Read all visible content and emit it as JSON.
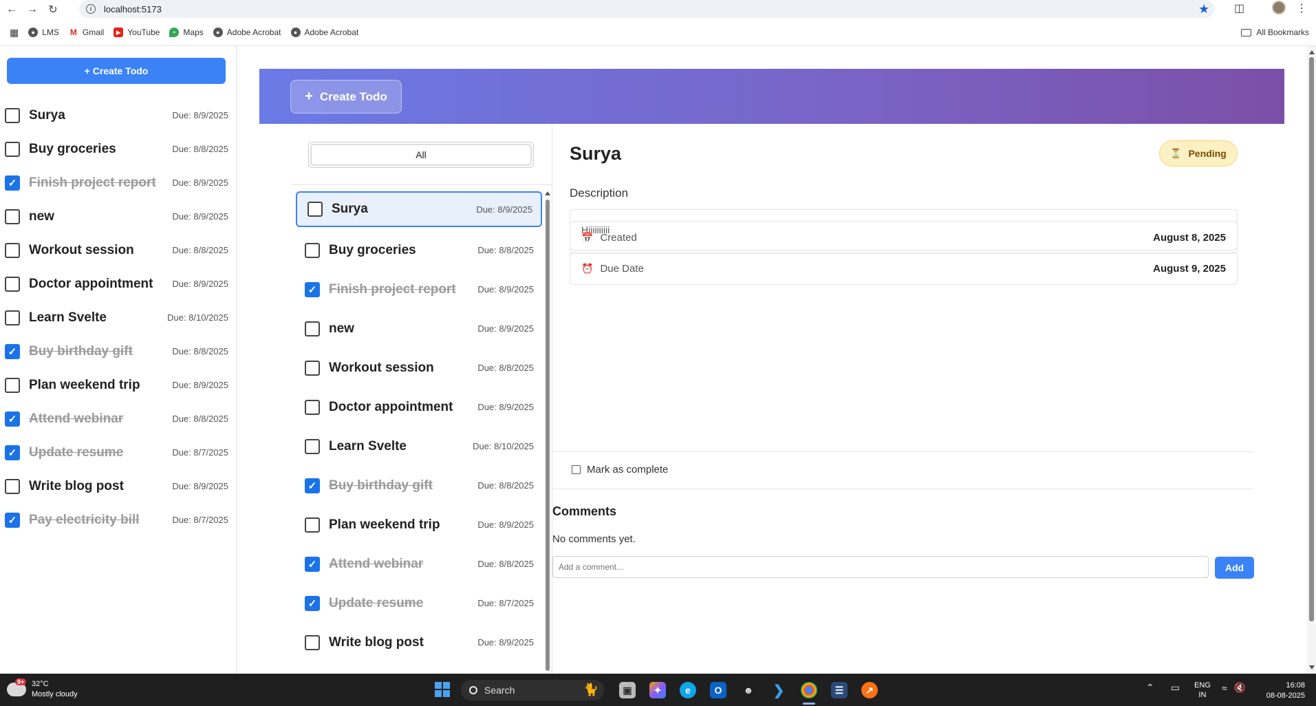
{
  "browser": {
    "url": "localhost:5173",
    "bookmarks": [
      {
        "label": "LMS",
        "icon": "globe-icon"
      },
      {
        "label": "Gmail",
        "icon": "gmail-icon"
      },
      {
        "label": "YouTube",
        "icon": "youtube-icon"
      },
      {
        "label": "Maps",
        "icon": "maps-icon"
      },
      {
        "label": "Adobe Acrobat",
        "icon": "globe-icon"
      },
      {
        "label": "Adobe Acrobat",
        "icon": "globe-icon"
      }
    ],
    "all_bookmarks": "All Bookmarks"
  },
  "sidebar": {
    "create_label": "+ Create Todo",
    "todos": [
      {
        "title": "Surya",
        "due": "Due: 8/9/2025",
        "done": false
      },
      {
        "title": "Buy groceries",
        "due": "Due: 8/8/2025",
        "done": false
      },
      {
        "title": "Finish project report",
        "due": "Due: 8/9/2025",
        "done": true
      },
      {
        "title": "new",
        "due": "Due: 8/9/2025",
        "done": false
      },
      {
        "title": "Workout session",
        "due": "Due: 8/8/2025",
        "done": false
      },
      {
        "title": "Doctor appointment",
        "due": "Due: 8/9/2025",
        "done": false
      },
      {
        "title": "Learn Svelte",
        "due": "Due: 8/10/2025",
        "done": false
      },
      {
        "title": "Buy birthday gift",
        "due": "Due: 8/8/2025",
        "done": true
      },
      {
        "title": "Plan weekend trip",
        "due": "Due: 8/9/2025",
        "done": false
      },
      {
        "title": "Attend webinar",
        "due": "Due: 8/8/2025",
        "done": true
      },
      {
        "title": "Update resume",
        "due": "Due: 8/7/2025",
        "done": true
      },
      {
        "title": "Write blog post",
        "due": "Due: 8/9/2025",
        "done": false
      },
      {
        "title": "Pay electricity bill",
        "due": "Due: 8/7/2025",
        "done": true
      }
    ]
  },
  "hero": {
    "create_label": "Create Todo",
    "plus": "+"
  },
  "middle": {
    "filter_label": "All",
    "todos": [
      {
        "title": "Surya",
        "due": "Due: 8/9/2025",
        "done": false,
        "selected": true
      },
      {
        "title": "Buy groceries",
        "due": "Due: 8/8/2025",
        "done": false
      },
      {
        "title": "Finish project report",
        "due": "Due: 8/9/2025",
        "done": true
      },
      {
        "title": "new",
        "due": "Due: 8/9/2025",
        "done": false
      },
      {
        "title": "Workout session",
        "due": "Due: 8/8/2025",
        "done": false
      },
      {
        "title": "Doctor appointment",
        "due": "Due: 8/9/2025",
        "done": false
      },
      {
        "title": "Learn Svelte",
        "due": "Due: 8/10/2025",
        "done": false
      },
      {
        "title": "Buy birthday gift",
        "due": "Due: 8/8/2025",
        "done": true
      },
      {
        "title": "Plan weekend trip",
        "due": "Due: 8/9/2025",
        "done": false
      },
      {
        "title": "Attend webinar",
        "due": "Due: 8/8/2025",
        "done": true
      },
      {
        "title": "Update resume",
        "due": "Due: 8/7/2025",
        "done": true
      },
      {
        "title": "Write blog post",
        "due": "Due: 8/9/2025",
        "done": false
      }
    ]
  },
  "detail": {
    "title": "Surya",
    "status": "Pending",
    "status_icon": "⏳",
    "description_label": "Description",
    "description": "Hiiiiiiiiii",
    "created_label": "Created",
    "created_icon": "📅",
    "created_value": "August 8, 2025",
    "due_label": "Due Date",
    "due_icon": "⏰",
    "due_value": "August 9, 2025",
    "mark_complete": "Mark as complete",
    "comments_title": "Comments",
    "no_comments": "No comments yet.",
    "comment_placeholder": "Add a comment...",
    "add_label": "Add"
  },
  "taskbar": {
    "temperature": "32°C",
    "weather": "Mostly cloudy",
    "weather_badge": "9+",
    "search_placeholder": "Search",
    "lang": "ENG",
    "region": "IN",
    "time": "16:08",
    "date": "08-08-2025"
  },
  "colors": {
    "accent": "#3b82f6",
    "hero_start": "#6a7ae6",
    "hero_end": "#7b4fa8",
    "badge_bg": "#fdf0c2"
  }
}
